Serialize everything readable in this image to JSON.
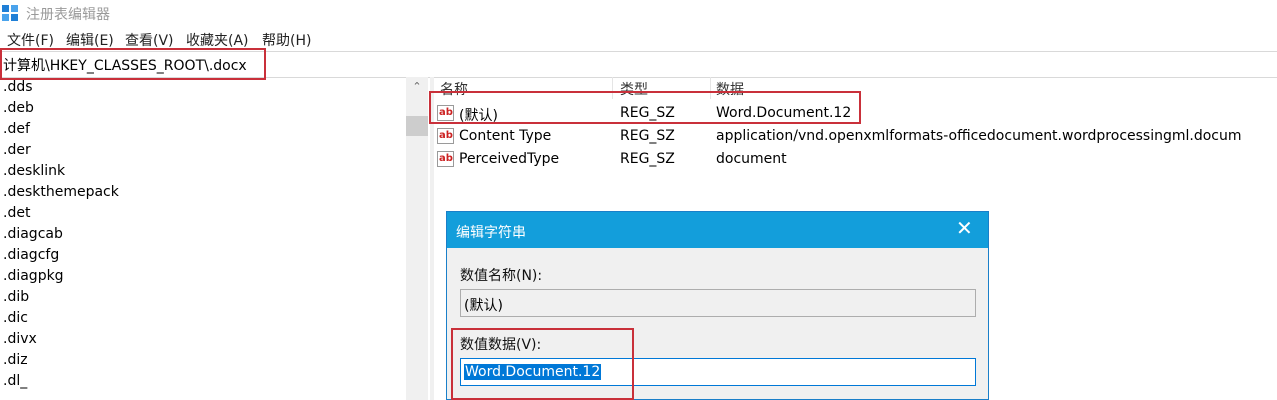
{
  "window": {
    "title": "注册表编辑器",
    "icon": "registry-editor-icon"
  },
  "menu": [
    "文件(F)",
    "编辑(E)",
    "查看(V)",
    "收藏夹(A)",
    "帮助(H)"
  ],
  "address": {
    "path": "计算机\\HKEY_CLASSES_ROOT\\.docx"
  },
  "tree": {
    "items": [
      ".dds",
      ".deb",
      ".def",
      ".der",
      ".desklink",
      ".deskthemepack",
      ".det",
      ".diagcab",
      ".diagcfg",
      ".diagpkg",
      ".dib",
      ".dic",
      ".divx",
      ".diz",
      ".dl_"
    ]
  },
  "list": {
    "columns": {
      "name": "名称",
      "type": "类型",
      "data": "数据"
    },
    "rows": [
      {
        "name": "(默认)",
        "type": "REG_SZ",
        "data": "Word.Document.12",
        "icon": "string-value-icon"
      },
      {
        "name": "Content Type",
        "type": "REG_SZ",
        "data": "application/vnd.openxmlformats-officedocument.wordprocessingml.docum",
        "icon": "string-value-icon"
      },
      {
        "name": "PerceivedType",
        "type": "REG_SZ",
        "data": "document",
        "icon": "string-value-icon"
      }
    ]
  },
  "dialog": {
    "title": "编辑字符串",
    "name_label": "数值名称(N):",
    "name_value": "(默认)",
    "data_label": "数值数据(V):",
    "data_value": "Word.Document.12",
    "close_icon": "close-icon"
  },
  "colors": {
    "highlight": "#c9303a",
    "dialog_title": "#139edb",
    "selection": "#0078d7"
  }
}
